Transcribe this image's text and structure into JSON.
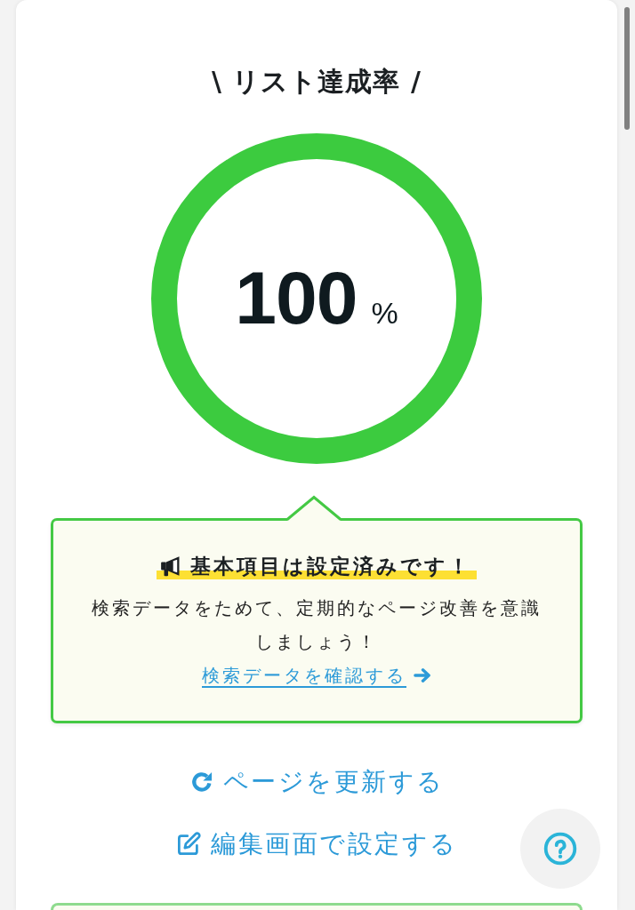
{
  "title": "\\ リスト達成率 /",
  "progress": {
    "level": 1,
    "value": "100",
    "unit": "%"
  },
  "notice": {
    "heading": "基本項目は設定済みです！",
    "body": "検索データをためて、定期的なページ改善を意識しましょう！",
    "link": "検索データを確認する"
  },
  "actions": [
    {
      "kind": "refresh",
      "label": "ページを更新する"
    },
    {
      "kind": "edit",
      "label": "編集画面で設定する"
    }
  ]
}
